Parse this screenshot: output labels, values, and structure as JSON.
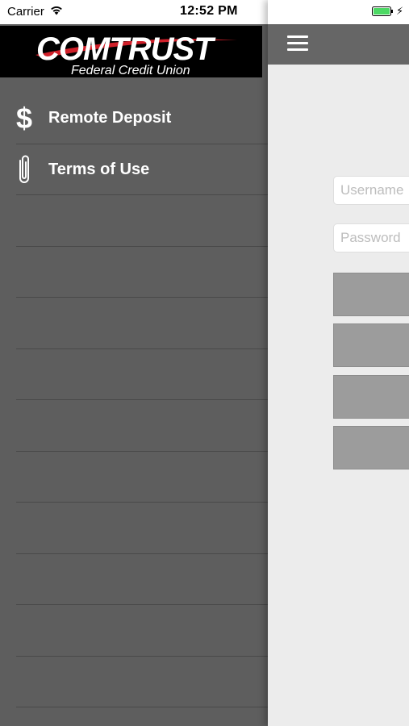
{
  "status_bar": {
    "carrier": "Carrier",
    "time": "12:52 PM",
    "battery_color": "#4cd964"
  },
  "logo": {
    "main": "COMTRUST",
    "sub": "Federal Credit Union",
    "accent_color": "#d0202a"
  },
  "drawer": {
    "items": [
      {
        "label": "Remote Deposit",
        "icon": "dollar-icon"
      },
      {
        "label": "Terms of Use",
        "icon": "paperclip-icon"
      }
    ]
  },
  "login": {
    "username_placeholder": "Username",
    "password_placeholder": "Password"
  },
  "colors": {
    "drawer_bg": "#5e5e5e",
    "navbar_bg": "#666666",
    "content_bg": "#ececec",
    "button_bg": "#9c9c9c"
  }
}
